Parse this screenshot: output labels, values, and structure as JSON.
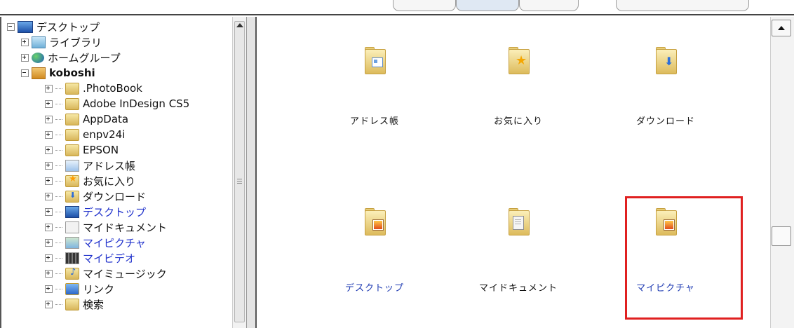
{
  "tree": {
    "items": [
      {
        "label": "デスクトップ",
        "icon": "desktop-icon",
        "expander": "minus"
      },
      {
        "label": "ライブラリ",
        "icon": "library-icon",
        "expander": "plus"
      },
      {
        "label": "ホームグループ",
        "icon": "homegroup-icon",
        "expander": "plus"
      },
      {
        "label": "koboshi",
        "icon": "user-folder-icon",
        "expander": "minus"
      },
      {
        "label": ".PhotoBook",
        "icon": "folder-icon",
        "expander": "plus"
      },
      {
        "label": "Adobe InDesign CS5",
        "icon": "folder-icon",
        "expander": "plus"
      },
      {
        "label": "AppData",
        "icon": "folder-icon",
        "expander": "plus"
      },
      {
        "label": "enpv24i",
        "icon": "folder-icon",
        "expander": "plus"
      },
      {
        "label": "EPSON",
        "icon": "folder-icon",
        "expander": "plus"
      },
      {
        "label": "アドレス帳",
        "icon": "contacts-icon",
        "expander": "plus"
      },
      {
        "label": "お気に入り",
        "icon": "favorites-icon",
        "expander": "plus"
      },
      {
        "label": "ダウンロード",
        "icon": "downloads-icon",
        "expander": "plus"
      },
      {
        "label": "デスクトップ",
        "icon": "desktop-folder-icon",
        "expander": "plus"
      },
      {
        "label": "マイドキュメント",
        "icon": "documents-icon",
        "expander": "plus"
      },
      {
        "label": "マイピクチャ",
        "icon": "pictures-icon",
        "expander": "plus"
      },
      {
        "label": "マイビデオ",
        "icon": "videos-icon",
        "expander": "plus"
      },
      {
        "label": "マイミュージック",
        "icon": "music-icon",
        "expander": "plus"
      },
      {
        "label": "リンク",
        "icon": "links-icon",
        "expander": "plus"
      },
      {
        "label": "検索",
        "icon": "search-icon",
        "expander": "plus"
      }
    ]
  },
  "content": {
    "items": [
      {
        "label": "アドレス帳",
        "icon": "contacts-folder-icon"
      },
      {
        "label": "お気に入り",
        "icon": "favorites-folder-icon"
      },
      {
        "label": "ダウンロード",
        "icon": "downloads-folder-icon"
      },
      {
        "label": "デスクトップ",
        "icon": "desktop-folder-icon"
      },
      {
        "label": "マイドキュメント",
        "icon": "documents-folder-icon"
      },
      {
        "label": "マイピクチャ",
        "icon": "pictures-folder-icon"
      }
    ]
  },
  "colors": {
    "highlight": "#e02020",
    "link_text": "#1f3bb3"
  }
}
